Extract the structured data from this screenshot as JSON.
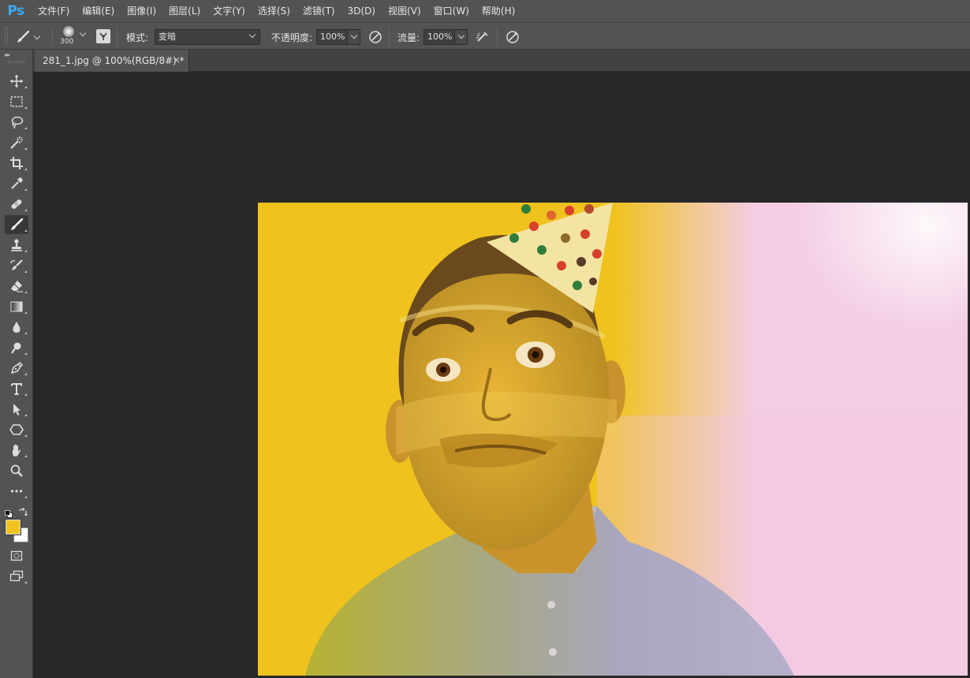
{
  "app": {
    "logo": "Ps"
  },
  "menu": [
    "文件(F)",
    "编辑(E)",
    "图像(I)",
    "图层(L)",
    "文字(Y)",
    "选择(S)",
    "滤镜(T)",
    "3D(D)",
    "视图(V)",
    "窗口(W)",
    "帮助(H)"
  ],
  "options": {
    "brush_size": "300",
    "mode_label": "模式:",
    "mode_value": "变暗",
    "opacity_label": "不透明度:",
    "opacity_value": "100%",
    "flow_label": "流量:",
    "flow_value": "100%"
  },
  "document": {
    "tab_title": "281_1.jpg @ 100%(RGB/8#) *",
    "close": "×"
  },
  "colors": {
    "foreground": "#f0c41c",
    "background": "#ffffff",
    "canvas_yellow": "#efc21e",
    "canvas_pink": "#f3cde4"
  },
  "tools": [
    "move-icon",
    "marquee-icon",
    "lasso-icon",
    "magic-wand-icon",
    "crop-icon",
    "eyedropper-icon",
    "healing-brush-icon",
    "brush-icon",
    "clone-stamp-icon",
    "history-brush-icon",
    "eraser-icon",
    "gradient-icon",
    "blur-icon",
    "dodge-icon",
    "pen-icon",
    "type-icon",
    "path-selection-icon",
    "shape-icon",
    "hand-icon",
    "zoom-icon",
    "more-tools-icon"
  ]
}
